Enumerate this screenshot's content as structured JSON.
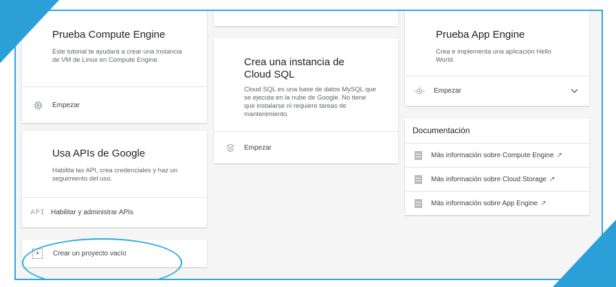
{
  "cards": {
    "compute": {
      "title": "Prueba Compute Engine",
      "description": "Este tutorial te ayudará a crear una instancia de VM de Linux en Compute Engine.",
      "action": "Empezar"
    },
    "apis": {
      "title": "Usa APIs de Google",
      "description": "Habilita las API, crea credenciales y haz un seguimiento del uso.",
      "icon_text": "API",
      "action": "Habilitar y administrar APIs"
    },
    "empty_project": {
      "action": "Crear un proyecto vacío"
    },
    "cloudsql": {
      "title": "Crea una instancia de Cloud SQL",
      "description": "Cloud SQL es una base de datos MySQL que se ejecuta en la nube de Google. No tiene que instalarse ni requiere tareas de mantenimiento.",
      "action": "Empezar"
    },
    "appengine": {
      "title": "Prueba App Engine",
      "description": "Crea e implementa una aplicación Hello World.",
      "action": "Empezar"
    }
  },
  "documentation": {
    "title": "Documentación",
    "links": [
      "Más información sobre Compute Engine",
      "Más información sobre Cloud Storage",
      "Más información sobre App Engine"
    ]
  },
  "colors": {
    "accent": "#29a8e0",
    "corner": "#2a9fd8"
  }
}
